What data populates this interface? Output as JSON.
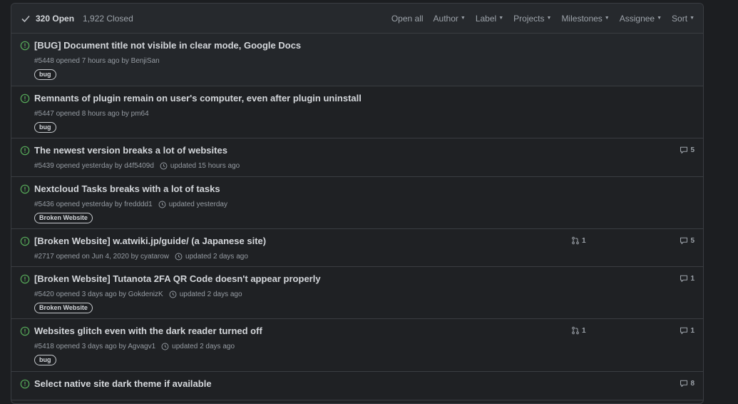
{
  "header": {
    "open_label": "320 Open",
    "closed_label": "1,922 Closed",
    "filters": [
      "Open all",
      "Author",
      "Label",
      "Projects",
      "Milestones",
      "Assignee",
      "Sort"
    ]
  },
  "issues": [
    {
      "title": "[BUG] Document title not visible in clear mode, Google Docs",
      "meta": "#5448 opened 7 hours ago by BenjiSan",
      "updated": "",
      "label": "bug",
      "comments": "",
      "prs": ""
    },
    {
      "title": "Remnants of plugin remain on user's computer, even after plugin uninstall",
      "meta": "#5447 opened 8 hours ago by pm64",
      "updated": "",
      "label": "bug",
      "comments": "",
      "prs": ""
    },
    {
      "title": "The newest version breaks a lot of websites",
      "meta": "#5439 opened yesterday by d4f5409d",
      "updated": "updated 15 hours ago",
      "label": "",
      "comments": "5",
      "prs": ""
    },
    {
      "title": "Nextcloud Tasks breaks with a lot of tasks",
      "meta": "#5436 opened yesterday by fredddd1",
      "updated": "updated yesterday",
      "label": "Broken Website",
      "comments": "",
      "prs": ""
    },
    {
      "title": "[Broken Website] w.atwiki.jp/guide/ (a Japanese site)",
      "meta": "#2717 opened on Jun 4, 2020 by cyatarow",
      "updated": "updated 2 days ago",
      "label": "",
      "comments": "5",
      "prs": "1"
    },
    {
      "title": "[Broken Website] Tutanota 2FA QR Code doesn't appear properly",
      "meta": "#5420 opened 3 days ago by GokdenizK",
      "updated": "updated 2 days ago",
      "label": "Broken Website",
      "comments": "1",
      "prs": ""
    },
    {
      "title": "Websites glitch even with the dark reader turned off",
      "meta": "#5418 opened 3 days ago by Agvagv1",
      "updated": "updated 2 days ago",
      "label": "bug",
      "comments": "1",
      "prs": "1"
    },
    {
      "title": "Select native site dark theme if available",
      "meta": "",
      "updated": "",
      "label": "",
      "comments": "8",
      "prs": ""
    }
  ],
  "colors": {
    "open_icon": "#57ab5a",
    "background": "#1c1e21",
    "border": "#3a3d42"
  }
}
